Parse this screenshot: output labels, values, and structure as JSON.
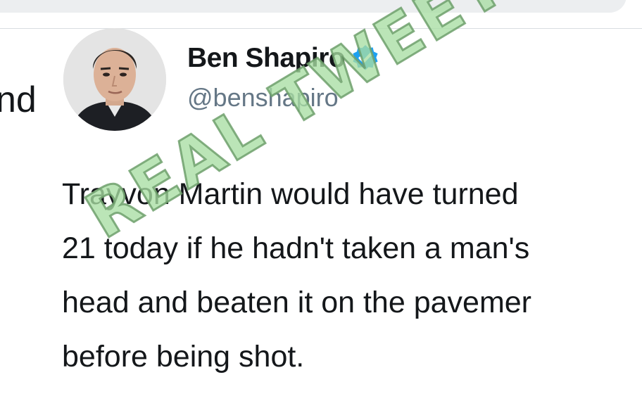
{
  "left_fragment": "nd",
  "tweet": {
    "author": {
      "display_name": "Ben Shapiro",
      "handle": "@benshapiro",
      "verified_icon": "verified-badge-icon",
      "avatar_icon": "avatar"
    },
    "lines": [
      "Trayvon Martin would have turned",
      "21 today if he hadn't taken a man's",
      "head and beaten it on the pavemer",
      "before being shot."
    ]
  },
  "watermark": {
    "text": "REAL TWEET",
    "color": "#a8dea3"
  },
  "colors": {
    "verified_blue": "#1da1f2",
    "handle_gray": "#657786",
    "text_dark": "#14171a"
  }
}
